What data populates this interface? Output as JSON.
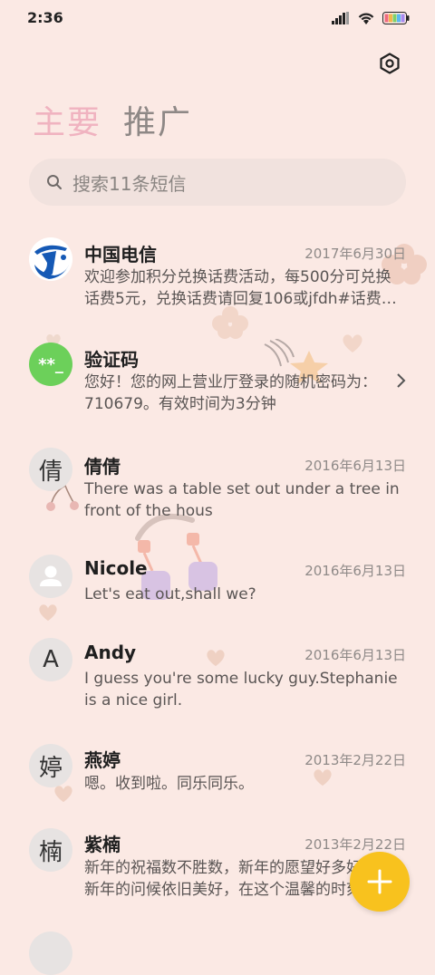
{
  "status_bar": {
    "time": "2:36"
  },
  "tabs": [
    {
      "label": "主要",
      "active": true
    },
    {
      "label": "推广",
      "active": false
    }
  ],
  "search": {
    "placeholder": "搜索11条短信"
  },
  "conversations": [
    {
      "name": "中国电信",
      "date": "2017年6月30日",
      "preview": "欢迎参加积分兑换话费活动，每500分可兑换话费5元，兑换话费请回复106或jfdh#话费…",
      "avatar_type": "telecom-logo"
    },
    {
      "name": "验证码",
      "date": "",
      "preview": "您好！您的网上营业厅登录的随机密码为：710679。有效时间为3分钟",
      "avatar_type": "otp",
      "avatar_text": "**_"
    },
    {
      "name": "倩倩",
      "date": "2016年6月13日",
      "preview": "There was a table set out under a tree in front of the hous",
      "avatar_type": "letter",
      "avatar_text": "倩"
    },
    {
      "name": "Nicole",
      "date": "2016年6月13日",
      "preview": "Let's eat out,shall we?",
      "avatar_type": "person"
    },
    {
      "name": "Andy",
      "date": "2016年6月13日",
      "preview": "I guess you're some lucky guy.Stephanie is a nice girl.",
      "avatar_type": "letter",
      "avatar_text": "A"
    },
    {
      "name": "燕婷",
      "date": "2013年2月22日",
      "preview": "嗯。收到啦。同乐同乐。",
      "avatar_type": "letter",
      "avatar_text": "婷"
    },
    {
      "name": "紫楠",
      "date": "2013年2月22日",
      "preview": "新年的祝福数不胜数，新年的愿望好多好多，新年的问候依旧美好，在这个温馨的时刻",
      "avatar_type": "letter",
      "avatar_text": "楠"
    }
  ],
  "colors": {
    "background": "#fbe9e4",
    "active_tab": "#f0b3c0",
    "fab": "#f8c21e",
    "otp_avatar": "#6cd05a",
    "telecom_blue": "#1559b5"
  }
}
